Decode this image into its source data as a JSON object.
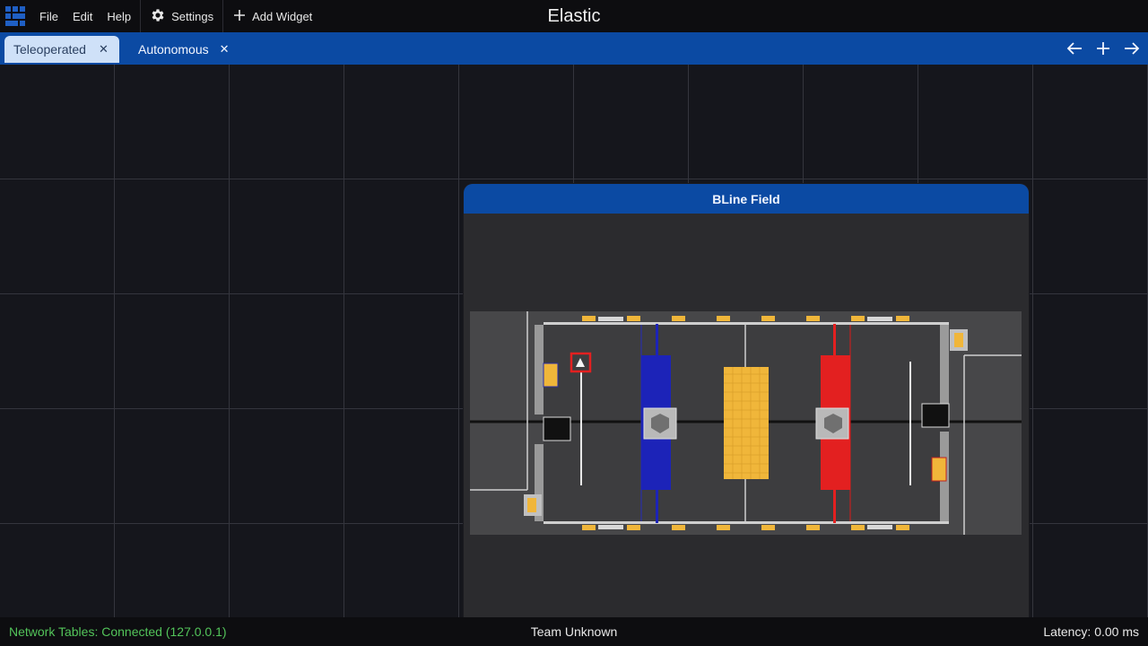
{
  "app": {
    "title": "Elastic",
    "logo_icon": "elastic-logo-icon"
  },
  "menu": {
    "file": "File",
    "edit": "Edit",
    "help": "Help",
    "settings": "Settings",
    "add_widget": "Add Widget"
  },
  "tabs": [
    {
      "label": "Teleoperated",
      "active": true
    },
    {
      "label": "Autonomous",
      "active": false
    }
  ],
  "tab_close_glyph": "✕",
  "nav_icons": [
    "arrow-left-icon",
    "plus-icon",
    "arrow-right-icon"
  ],
  "widget": {
    "title": "BLine Field"
  },
  "status": {
    "connection": "Network Tables: Connected (127.0.0.1)",
    "team": "Team Unknown",
    "latency": "Latency:  0.00 ms"
  },
  "colors": {
    "accent": "#0b4aa3",
    "active_tab": "#cfe1f8",
    "connected": "#53c45a",
    "alliance_blue": "#1c23b8",
    "alliance_red": "#e32020",
    "fuel": "#f0b63a"
  }
}
